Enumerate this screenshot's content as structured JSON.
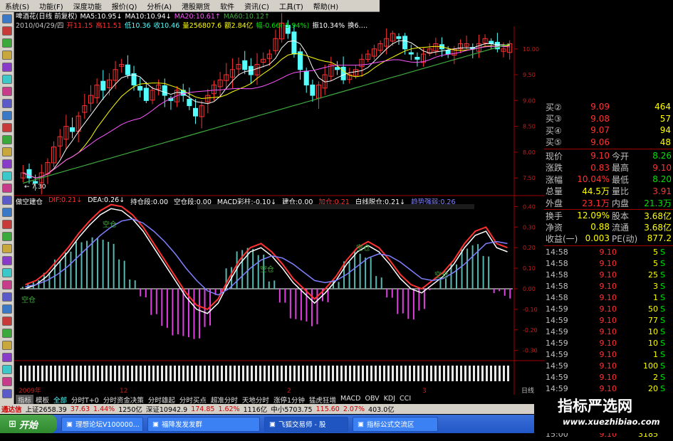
{
  "menu": [
    "系统(S)",
    "功能(F)",
    "深度功能",
    "报价(Q)",
    "分析(A)",
    "港股期货",
    "软件",
    "资讯(C)",
    "工具(T)",
    "帮助(H)"
  ],
  "colors": {
    "up": "#ff3232",
    "down": "#54ffff",
    "yellow": "#ffff00",
    "white": "#ffffff",
    "magenta": "#ff44ff",
    "green": "#00e000",
    "purple": "#ff55ff",
    "ma_green": "#3faa3f"
  },
  "info": {
    "row1": [
      {
        "t": "啤酒花(日线 前复权)",
        "c": "#ffffff"
      },
      {
        "t": "MA5:10.95↓",
        "c": "#ffffff"
      },
      {
        "t": "MA10:10.94↓",
        "c": "#ffffff"
      },
      {
        "t": "MA20:10.61↑",
        "c": "#ff55ff"
      },
      {
        "t": "MA60:10.12↑",
        "c": "#3faa3f"
      }
    ],
    "row2": [
      {
        "t": "2010/04/29/四",
        "c": "#c0c0c0"
      },
      {
        "t": "开11.15",
        "c": "#ff3232"
      },
      {
        "t": "高11.51",
        "c": "#ff3232"
      },
      {
        "t": "低10.36",
        "c": "#54ffff"
      },
      {
        "t": "收10.46",
        "c": "#54ffff"
      },
      {
        "t": "量256807.6",
        "c": "#ffff00"
      },
      {
        "t": "额2.84亿",
        "c": "#ffff00"
      },
      {
        "t": "幅-0.66(-5.94%)",
        "c": "#00e000"
      },
      {
        "t": "振10.34%",
        "c": "#ffffff"
      },
      {
        "t": "换6.…",
        "c": "#ffffff"
      }
    ]
  },
  "chart_data": [
    {
      "type": "candlestick",
      "title": "啤酒花(日线 前复权)",
      "y_ticks": [
        "10.00",
        "9.50",
        "9.00",
        "8.50",
        "8.00",
        "7.50"
      ],
      "low_annotation": "← 7.30",
      "closes": [
        7.6,
        7.5,
        7.4,
        7.6,
        7.8,
        8.1,
        8.3,
        8.5,
        8.4,
        8.7,
        8.9,
        9.1,
        9.3,
        9.2,
        9.4,
        9.6,
        9.7,
        9.5,
        9.3,
        9.2,
        9.0,
        9.2,
        9.3,
        9.1,
        9.0,
        9.2,
        9.1,
        8.9,
        8.7,
        8.9,
        9.1,
        9.3,
        9.4,
        9.5,
        9.6,
        9.7,
        9.6,
        9.5,
        9.7,
        9.8,
        9.9,
        10.2,
        10.5,
        10.3,
        9.9,
        9.6,
        9.3,
        9.1,
        9.3,
        9.5,
        9.7,
        9.6,
        9.4,
        9.5,
        9.6,
        9.8,
        9.9,
        10.0,
        10.1,
        10.2,
        10.3,
        10.2,
        10.0,
        9.9,
        9.8,
        9.9,
        10.0,
        10.1,
        10.0,
        9.9,
        10.0,
        10.1,
        10.1,
        10.0,
        10.1,
        10.2,
        10.1,
        10.0,
        10.0,
        10.1
      ]
    },
    {
      "type": "macd",
      "labels": [
        {
          "t": "做空建仓",
          "c": "#ffffff"
        },
        {
          "t": "DIF:0.21↓",
          "c": "#ff3232"
        },
        {
          "t": "DEA:0.26↓",
          "c": "#ffffff"
        },
        {
          "t": "持仓段:0.00",
          "c": "#ffffff"
        },
        {
          "t": "空仓段:0.00",
          "c": "#ffffff"
        },
        {
          "t": "MACD彩柱:-0.10↓",
          "c": "#ffffff"
        },
        {
          "t": "建仓:0.00",
          "c": "#ffffff"
        },
        {
          "t": "加仓:0.21",
          "c": "#ff3232"
        },
        {
          "t": "白线脱仓:0.21↓",
          "c": "#ffffff"
        },
        {
          "t": "趋势强弱:0.26",
          "c": "#8080ff"
        }
      ],
      "y_ticks": [
        "0.40",
        "0.30",
        "0.20",
        "0.10",
        "0.00",
        "-0.10",
        "-0.20",
        "-0.30"
      ],
      "annotations": [
        "空仓",
        "空仓",
        "空仓",
        "空仓",
        "空仓"
      ],
      "dif": [
        0.02,
        0.04,
        0.08,
        0.14,
        0.2,
        0.27,
        0.33,
        0.38,
        0.41,
        0.4,
        0.36,
        0.3,
        0.22,
        0.14,
        0.06,
        -0.02,
        -0.08,
        -0.1,
        -0.05,
        0.05,
        0.14,
        0.2,
        0.22,
        0.18,
        0.12,
        0.05,
        0.0,
        -0.05,
        0.0,
        0.06,
        0.14,
        0.2,
        0.23,
        0.2,
        0.14,
        0.07,
        0.02,
        0.0,
        0.04,
        0.08,
        0.14,
        0.22,
        0.28,
        0.3,
        0.22,
        0.2
      ],
      "dea": [
        0.01,
        0.02,
        0.04,
        0.07,
        0.11,
        0.16,
        0.21,
        0.26,
        0.3,
        0.33,
        0.34,
        0.32,
        0.28,
        0.23,
        0.17,
        0.1,
        0.04,
        -0.01,
        -0.03,
        0.0,
        0.05,
        0.1,
        0.14,
        0.16,
        0.15,
        0.12,
        0.08,
        0.04,
        0.03,
        0.04,
        0.07,
        0.11,
        0.15,
        0.17,
        0.16,
        0.13,
        0.09,
        0.05,
        0.04,
        0.05,
        0.08,
        0.12,
        0.17,
        0.22,
        0.23,
        0.22
      ]
    }
  ],
  "quote": {
    "bids": [
      {
        "k": "买②",
        "p": "9.09",
        "v": "464"
      },
      {
        "k": "买③",
        "p": "9.08",
        "v": "57"
      },
      {
        "k": "买④",
        "p": "9.07",
        "v": "94"
      },
      {
        "k": "买⑤",
        "p": "9.06",
        "v": "48"
      }
    ],
    "stats": [
      {
        "a": "现价",
        "av": "9.10",
        "b": "今开",
        "bv": "8.26"
      },
      {
        "a": "涨跌",
        "av": "0.83",
        "b": "最高",
        "bv": "9.10"
      },
      {
        "a": "涨幅",
        "av": "10.04%",
        "b": "最低",
        "bv": "8.20"
      },
      {
        "a": "总量",
        "av": "44.5万",
        "b": "量比",
        "bv": "3.91"
      },
      {
        "a": "外盘",
        "av": "23.1万",
        "b": "内盘",
        "bv": "21.3万"
      }
    ],
    "stats2": [
      {
        "a": "换手",
        "av": "12.09%",
        "b": "股本",
        "bv": "3.68亿"
      },
      {
        "a": "净资",
        "av": "0.88",
        "b": "流通",
        "bv": "3.68亿"
      },
      {
        "a": "收益(一)",
        "av": "0.003",
        "b": "PE(动)",
        "bv": "877.2"
      }
    ],
    "ticks": [
      {
        "t": "14:58",
        "p": "9.10",
        "v": "5",
        "s": "S"
      },
      {
        "t": "14:58",
        "p": "9.10",
        "v": "5",
        "s": "S"
      },
      {
        "t": "14:58",
        "p": "9.10",
        "v": "25",
        "s": "S"
      },
      {
        "t": "14:58",
        "p": "9.10",
        "v": "3",
        "s": "S"
      },
      {
        "t": "14:58",
        "p": "9.10",
        "v": "1",
        "s": "S"
      },
      {
        "t": "14:59",
        "p": "9.10",
        "v": "50",
        "s": "S"
      },
      {
        "t": "14:59",
        "p": "9.10",
        "v": "77",
        "s": "S"
      },
      {
        "t": "14:59",
        "p": "9.10",
        "v": "10",
        "s": "S"
      },
      {
        "t": "14:59",
        "p": "9.10",
        "v": "10",
        "s": "S"
      },
      {
        "t": "14:59",
        "p": "9.10",
        "v": "1",
        "s": "S"
      },
      {
        "t": "14:59",
        "p": "9.10",
        "v": "100",
        "s": "S"
      },
      {
        "t": "14:59",
        "p": "9.10",
        "v": "2",
        "s": "S"
      },
      {
        "t": "14:59",
        "p": "9.10",
        "v": "20",
        "s": "S"
      },
      {
        "t": "14:59",
        "p": "9.10",
        "v": "10",
        "s": "S"
      },
      {
        "t": "14:59",
        "p": "9.10",
        "v": "1",
        "s": "S"
      },
      {
        "t": "14:59",
        "p": "9.10",
        "v": "4",
        "s": "S"
      },
      {
        "t": "15:00",
        "p": "9.10",
        "v": "3185",
        "s": ""
      }
    ]
  },
  "axis_labels": {
    "year": "2009年",
    "m1": "12",
    "m2": "2",
    "m3": "3",
    "day": "日线"
  },
  "indicator_tabs": [
    "指标",
    "模板",
    "全部",
    "分时T+0",
    "分时资金决策",
    "分时雄起",
    "分时买点",
    "超准分时",
    "天地分时",
    "涨停1分钟",
    "猛虎狂增",
    "MACD",
    "OBV",
    "KDJ",
    "CCI"
  ],
  "ticker": [
    {
      "t": "通达信",
      "c": "#cc0000"
    },
    {
      "t": "上证2658.39",
      "c": "#000000"
    },
    {
      "t": "37.63",
      "c": "#cc0000"
    },
    {
      "t": "1.44%",
      "c": "#cc0000"
    },
    {
      "t": "1250亿",
      "c": "#000000"
    },
    {
      "t": "深证10942.9",
      "c": "#000000"
    },
    {
      "t": "174.85",
      "c": "#cc0000"
    },
    {
      "t": "1.62%",
      "c": "#cc0000"
    },
    {
      "t": "1116亿",
      "c": "#000000"
    },
    {
      "t": "中小5703.75",
      "c": "#000000"
    },
    {
      "t": "115.60",
      "c": "#cc0000"
    },
    {
      "t": "2.07%",
      "c": "#cc0000"
    },
    {
      "t": "403.0亿",
      "c": "#000000"
    }
  ],
  "taskbar": {
    "start": "开始",
    "tasks": [
      "理想论坛V100000...",
      "福降发发发群",
      "飞狐交易师 - 股",
      "指标公式交流区"
    ]
  },
  "watermark": {
    "cn": "指标严选网",
    "url": "www.xuezhibiao.com"
  }
}
